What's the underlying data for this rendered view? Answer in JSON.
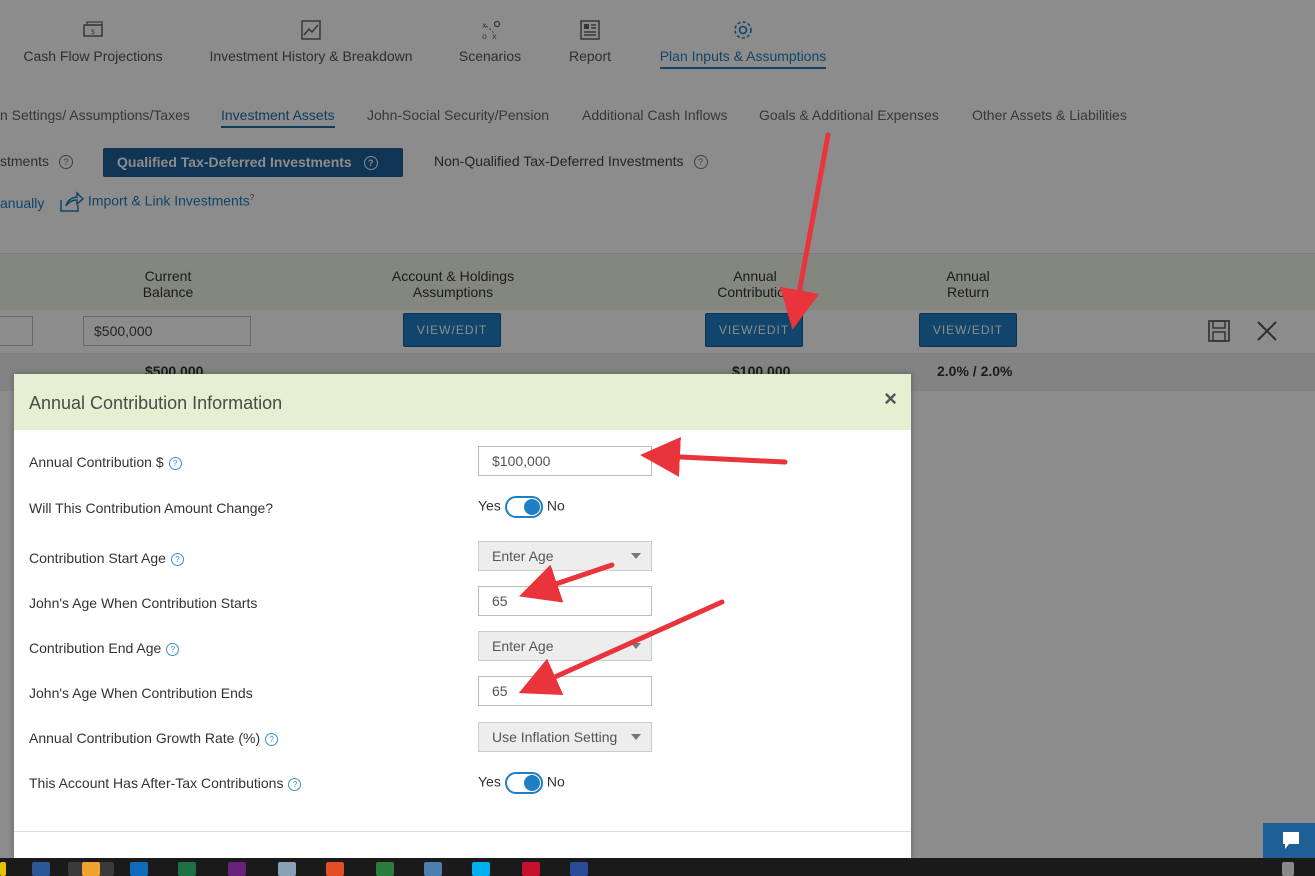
{
  "topnav": [
    {
      "label": "Cash Flow Projections",
      "icon": "cash-icon"
    },
    {
      "label": "Investment History & Breakdown",
      "icon": "chart-icon"
    },
    {
      "label": "Scenarios",
      "icon": "scenarios-icon"
    },
    {
      "label": "Report",
      "icon": "report-icon"
    },
    {
      "label": "Plan Inputs & Assumptions",
      "icon": "gear-icon",
      "active": true
    }
  ],
  "subtabs": [
    {
      "label": "n Settings/ Assumptions/Taxes"
    },
    {
      "label": "Investment Assets",
      "active": true
    },
    {
      "label": "John-Social Security/Pension"
    },
    {
      "label": "Additional Cash Inflows"
    },
    {
      "label": "Goals & Additional Expenses"
    },
    {
      "label": "Other Assets & Liabilities"
    }
  ],
  "invtype": {
    "left_partial": "stments",
    "active": "Qualified Tax-Deferred Investments",
    "other": "Non-Qualified Tax-Deferred Investments",
    "help": "?"
  },
  "actions": {
    "manual_partial": "anually",
    "import": "Import & Link Investments",
    "help": "?"
  },
  "table": {
    "headers": {
      "balance_1": "Current",
      "balance_2": "Balance",
      "holdings_1": "Account & Holdings",
      "holdings_2": "Assumptions",
      "contribution_1": "Annual",
      "contribution_2": "Contribution",
      "return_1": "Annual",
      "return_2": "Return"
    },
    "row": {
      "balance": "$500,000",
      "btn": "VIEW/EDIT"
    },
    "totals": {
      "balance": "$500,000",
      "contribution": "$100,000",
      "return": "2.0% / 2.0%"
    }
  },
  "modal": {
    "title": "Annual Contribution Information",
    "close": "×",
    "help": "?",
    "fields": {
      "annual_label": "Annual Contribution $",
      "annual_value": "$100,000",
      "change_label": "Will This Contribution Amount Change?",
      "start_age_label": "Contribution Start Age",
      "start_age_value": "Enter Age",
      "start_john_label": "John's Age When Contribution Starts",
      "start_john_value": "65",
      "end_age_label": "Contribution End Age",
      "end_age_value": "Enter Age",
      "end_john_label": "John's Age When Contribution Ends",
      "end_john_value": "65",
      "growth_label": "Annual Contribution Growth Rate (%)",
      "growth_value": "Use Inflation Setting",
      "aftertax_label": "This Account Has After-Tax Contributions"
    },
    "yes": "Yes",
    "no": "No"
  },
  "colors": {
    "accent": "#1f7fc4",
    "arrow": "#e8343a",
    "header_green": "#e5f0d3"
  }
}
